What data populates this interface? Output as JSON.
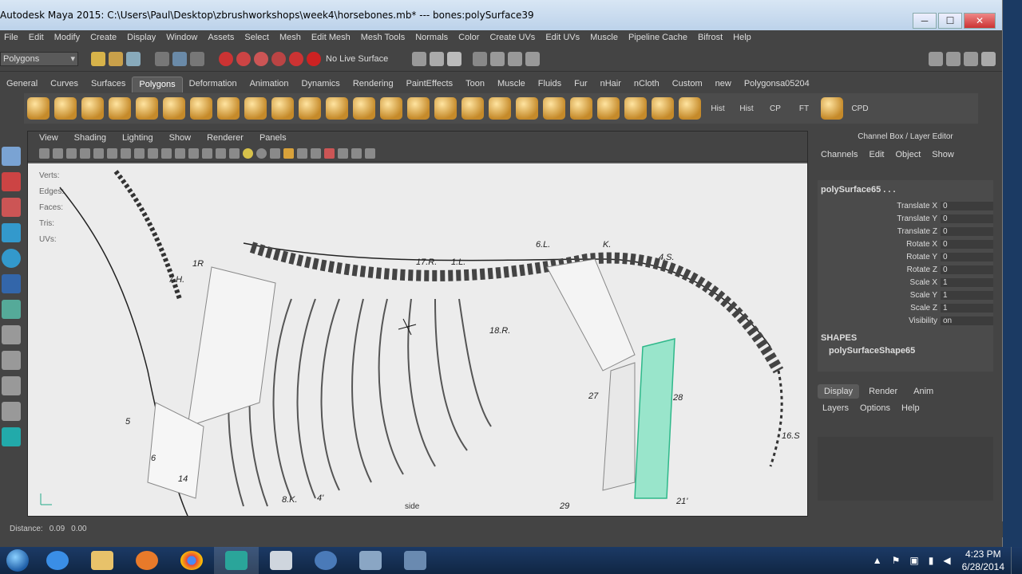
{
  "window": {
    "title": "Autodesk Maya 2015: C:\\Users\\Paul\\Desktop\\zbrushworkshops\\week4\\horsebones.mb*  ---  bones:polySurface39",
    "buttons": {
      "minimize": "─",
      "maximize": "☐",
      "close": "✕"
    }
  },
  "menubar": [
    "File",
    "Edit",
    "Modify",
    "Create",
    "Display",
    "Window",
    "Assets",
    "Select",
    "Mesh",
    "Edit Mesh",
    "Mesh Tools",
    "Normals",
    "Color",
    "Create UVs",
    "Edit UVs",
    "Muscle",
    "Pipeline Cache",
    "Bifrost",
    "Help"
  ],
  "status": {
    "mode": "Polygons",
    "live_surface": "No Live Surface"
  },
  "shelf_tabs": [
    "General",
    "Curves",
    "Surfaces",
    "Polygons",
    "Deformation",
    "Animation",
    "Dynamics",
    "Rendering",
    "PaintEffects",
    "Toon",
    "Muscle",
    "Fluids",
    "Fur",
    "nHair",
    "nCloth",
    "Custom",
    "new",
    "Polygonsa05204"
  ],
  "active_shelf_tab": "Polygons",
  "shelf_labels": [
    "Hist",
    "Hist",
    "CP",
    "FT",
    "CPD"
  ],
  "viewport": {
    "menu": [
      "View",
      "Shading",
      "Lighting",
      "Show",
      "Renderer",
      "Panels"
    ],
    "hud": [
      {
        "label": "Verts:"
      },
      {
        "label": "Edges:"
      },
      {
        "label": "Faces:"
      },
      {
        "label": "Tris:"
      },
      {
        "label": "UVs:"
      }
    ],
    "camera_label": "side",
    "plate_labels": [
      "7.H.",
      "1R",
      "17.R.",
      "1.L.",
      "6.L.",
      "K.",
      "4.S.",
      "18.R.",
      "27",
      "28",
      "5",
      "6",
      "14",
      "8.K.",
      "4'",
      "29",
      "21'",
      "16.S"
    ]
  },
  "channel_box": {
    "title": "Channel Box / Layer Editor",
    "menu": [
      "Channels",
      "Edit",
      "Object",
      "Show"
    ],
    "object": "polySurface65 . . .",
    "attributes": [
      {
        "name": "Translate X",
        "value": "0"
      },
      {
        "name": "Translate Y",
        "value": "0"
      },
      {
        "name": "Translate Z",
        "value": "0"
      },
      {
        "name": "Rotate X",
        "value": "0"
      },
      {
        "name": "Rotate Y",
        "value": "0"
      },
      {
        "name": "Rotate Z",
        "value": "0"
      },
      {
        "name": "Scale X",
        "value": "1"
      },
      {
        "name": "Scale Y",
        "value": "1"
      },
      {
        "name": "Scale Z",
        "value": "1"
      },
      {
        "name": "Visibility",
        "value": "on"
      }
    ],
    "shapes_header": "SHAPES",
    "shape": "polySurfaceShape65",
    "layer_tabs": [
      "Display",
      "Render",
      "Anim"
    ],
    "layer_menu": [
      "Layers",
      "Options",
      "Help"
    ]
  },
  "help_line": {
    "label": "Distance:",
    "value1": "0.09",
    "value2": "0.00"
  },
  "taskbar": {
    "time": "4:23 PM",
    "date": "6/28/2014"
  },
  "colors": {
    "maya_bg": "#444444",
    "selection_green": "#3fe0a8",
    "taskbar": "#1c3a66"
  }
}
